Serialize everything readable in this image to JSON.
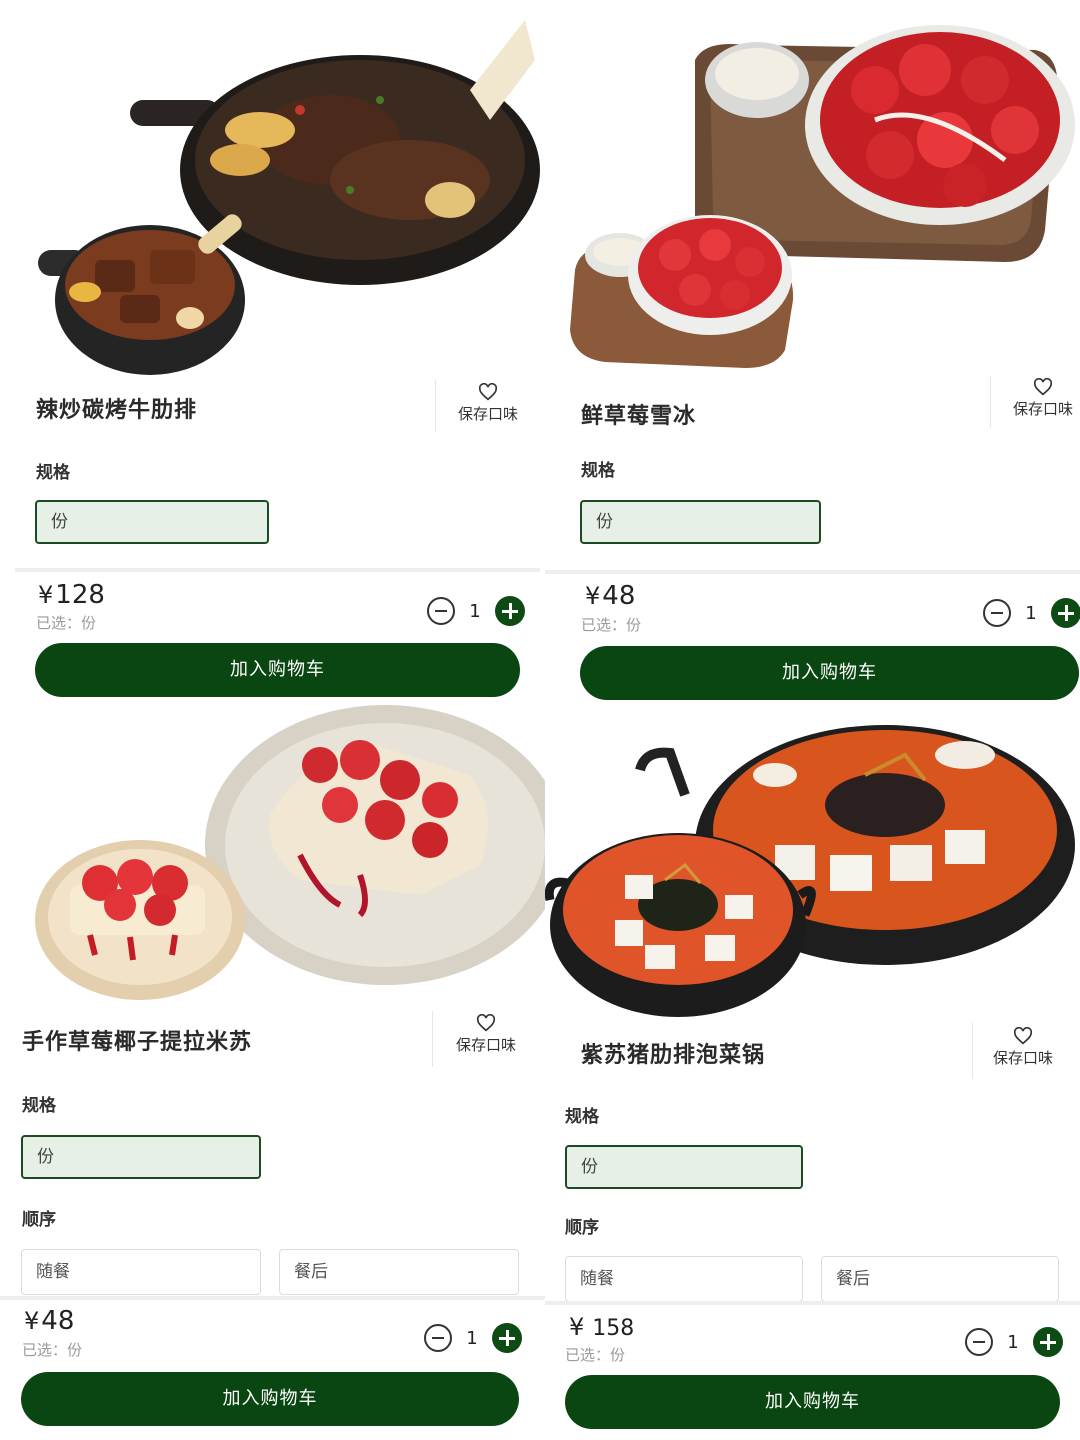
{
  "labels": {
    "save_flavor": "保存口味",
    "spec": "规格",
    "order": "顺序",
    "add_to_cart": "加入购物车",
    "currency": "¥"
  },
  "cards": [
    {
      "title": "辣炒碳烤牛肋排",
      "spec_option": "份",
      "price": "128",
      "selected": "已选：份",
      "qty": "1",
      "image": "beef-short-rib-pans"
    },
    {
      "title": "鲜草莓雪冰",
      "spec_option": "份",
      "price": "48",
      "selected": "已选：份",
      "qty": "1",
      "image": "strawberry-bingsu-trays"
    },
    {
      "title": "手作草莓椰子提拉米苏",
      "spec_option": "份",
      "order_options": [
        "随餐",
        "餐后"
      ],
      "price": "48",
      "selected": "已选：份",
      "qty": "1",
      "image": "strawberry-tiramisu-plates"
    },
    {
      "title": "紫苏猪肋排泡菜锅",
      "spec_option": "份",
      "order_options": [
        "随餐",
        "餐后"
      ],
      "price": "158",
      "selected": "已选：份",
      "qty": "1",
      "image": "kimchi-pork-rib-hotpot"
    }
  ],
  "colors": {
    "accent": "#0a4612",
    "spec_bg": "#e7f0e6",
    "spec_border": "#1d4a22"
  }
}
